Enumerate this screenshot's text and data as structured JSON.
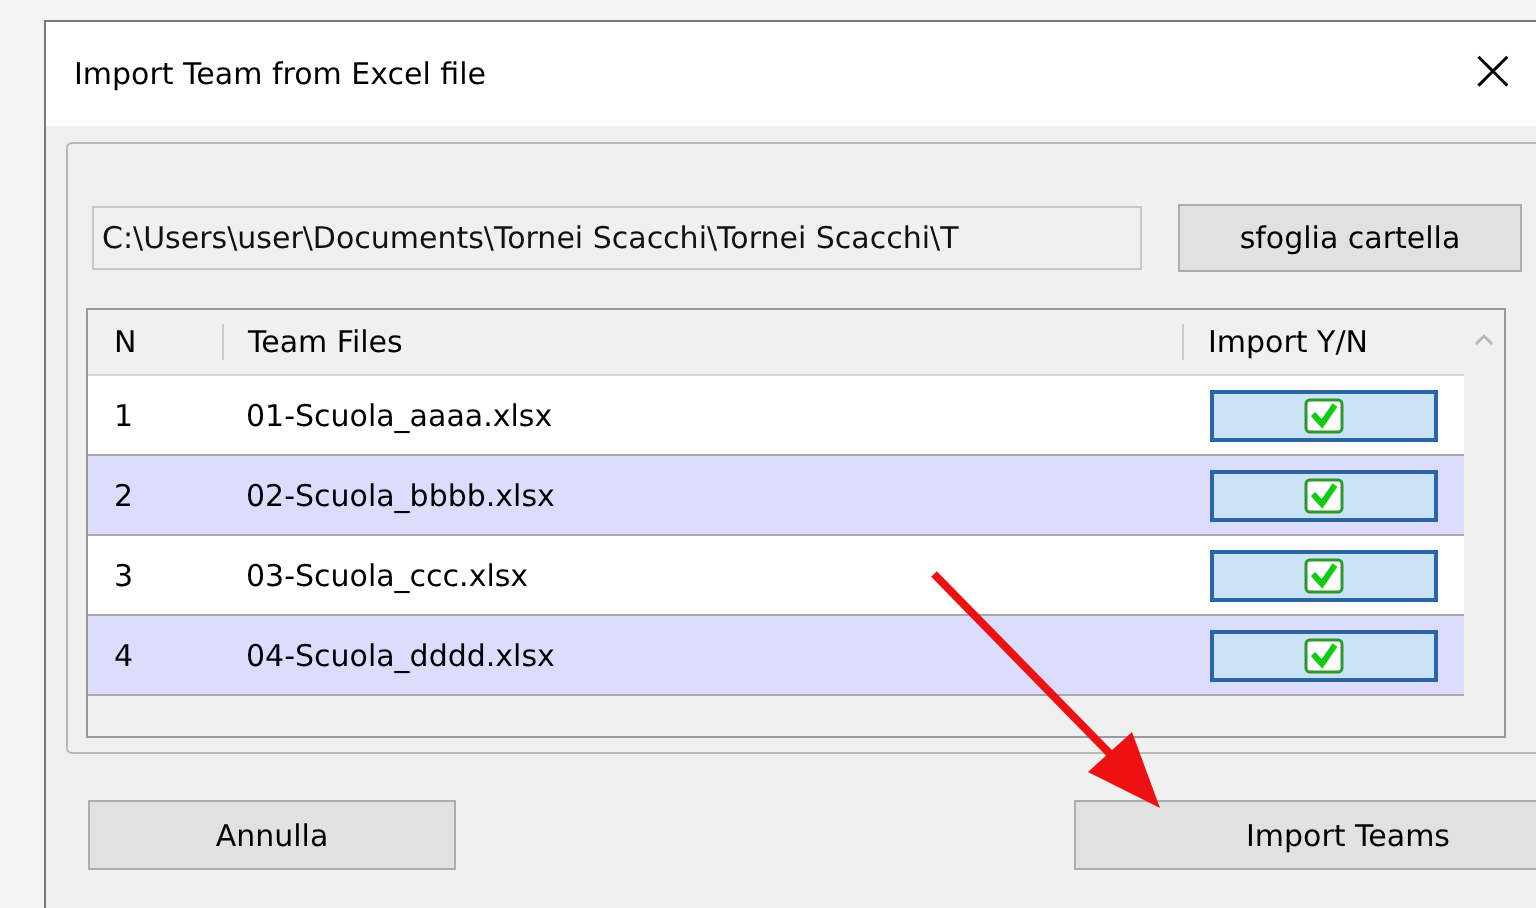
{
  "window": {
    "title": "Import Team from Excel file",
    "close": "×"
  },
  "folder": {
    "path": "C:\\Users\\user\\Documents\\Tornei Scacchi\\Tornei Scacchi\\T",
    "browse_button": "sfoglia cartella"
  },
  "table": {
    "columns": [
      "N",
      "Team Files",
      "Import Y/N"
    ],
    "rows": [
      {
        "n": "1",
        "file": "01-Scuola_aaaa.xlsx",
        "checked": true
      },
      {
        "n": "2",
        "file": "02-Scuola_bbbb.xlsx",
        "checked": true
      },
      {
        "n": "3",
        "file": "03-Scuola_ccc.xlsx",
        "checked": true
      },
      {
        "n": "4",
        "file": "04-Scuola_dddd.xlsx",
        "checked": true
      }
    ]
  },
  "buttons": [
    "Annulla",
    "Import Teams"
  ]
}
